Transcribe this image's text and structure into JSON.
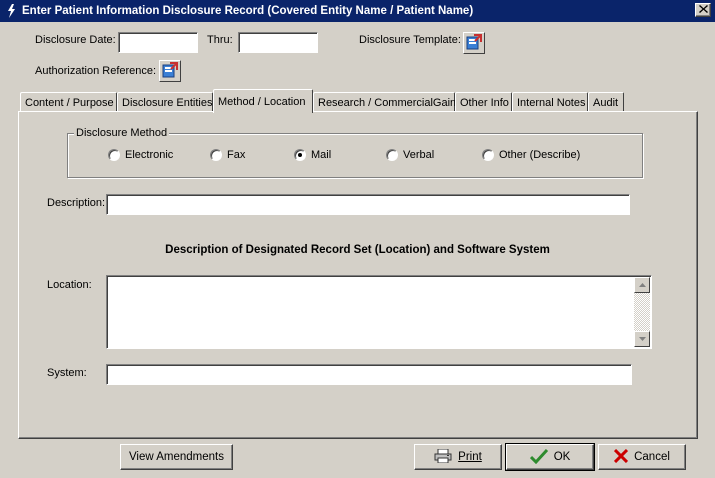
{
  "window": {
    "title": "Enter Patient Information Disclosure Record (Covered Entity Name / Patient Name)",
    "close_icon": "close-icon"
  },
  "header": {
    "disclosure_date_label": "Disclosure Date:",
    "disclosure_date_value": "",
    "thru_label": "Thru:",
    "thru_value": "",
    "template_label": "Disclosure Template:",
    "authorization_label": "Authorization Reference:"
  },
  "tabs": [
    {
      "label": "Content / Purpose"
    },
    {
      "label": "Disclosure Entities"
    },
    {
      "label": "Method / Location"
    },
    {
      "label": "Research / CommercialGain"
    },
    {
      "label": "Other Info"
    },
    {
      "label": "Internal Notes"
    },
    {
      "label": "Audit"
    }
  ],
  "active_tab": "Method / Location",
  "method": {
    "group_label": "Disclosure Method",
    "options": [
      {
        "label": "Electronic",
        "checked": false
      },
      {
        "label": "Fax",
        "checked": false
      },
      {
        "label": "Mail",
        "checked": true
      },
      {
        "label": "Verbal",
        "checked": false
      },
      {
        "label": "Other (Describe)",
        "checked": false
      }
    ]
  },
  "description": {
    "label": "Description:",
    "value": ""
  },
  "section_heading": "Description of Designated Record Set (Location) and Software System",
  "location": {
    "label": "Location:",
    "value": ""
  },
  "system": {
    "label": "System:",
    "value": ""
  },
  "buttons": {
    "view_amendments": "View Amendments",
    "print": "Print",
    "ok": "OK",
    "cancel": "Cancel"
  },
  "colors": {
    "titlebar": "#0a246a",
    "face": "#d4d0c8",
    "ok_check": "#2e8b2e",
    "cancel_x": "#cc0000"
  }
}
